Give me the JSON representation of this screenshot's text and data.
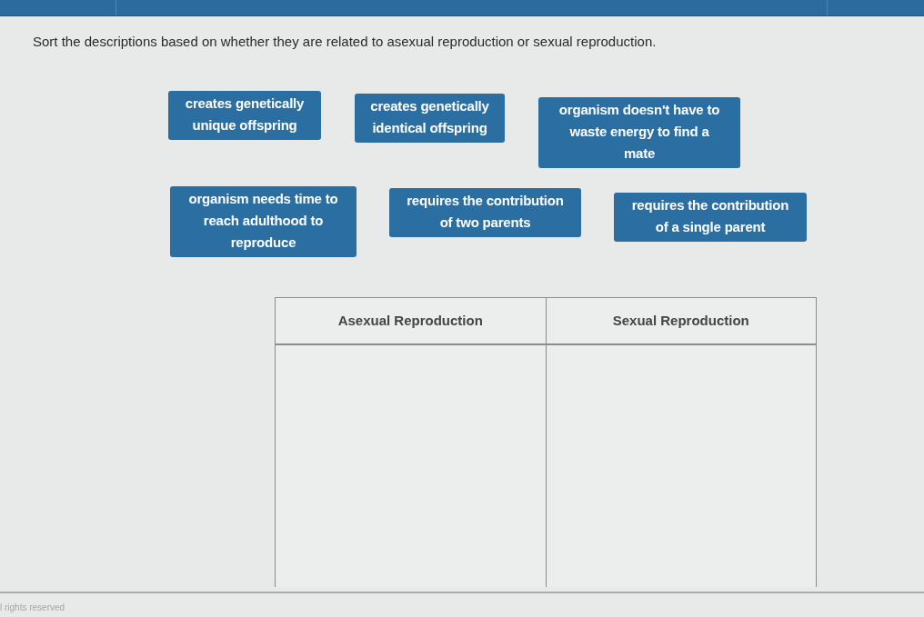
{
  "instruction": "Sort the descriptions based on whether they are related to asexual reproduction or sexual reproduction.",
  "tile_rows": [
    [
      "creates genetically unique offspring",
      "creates genetically identical offspring",
      "organism doesn't have to waste energy to find a mate"
    ],
    [
      "organism needs time to reach adulthood to reproduce",
      "requires the contribution of two parents",
      "requires the contribution of a single parent"
    ]
  ],
  "sort_table": {
    "columns": [
      "Asexual Reproduction",
      "Sexual Reproduction"
    ]
  },
  "footer": "l rights reserved"
}
